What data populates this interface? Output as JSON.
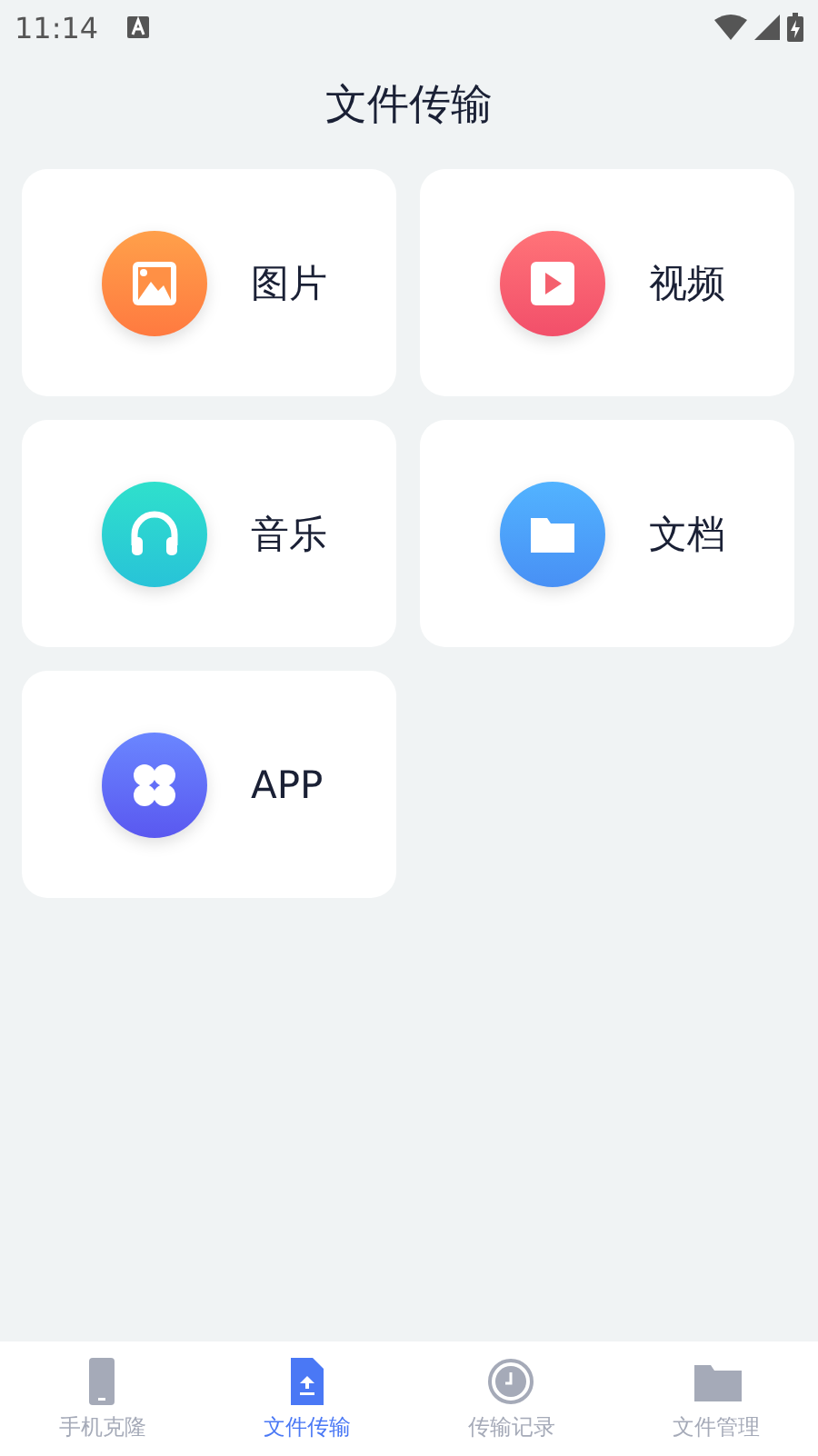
{
  "status_bar": {
    "time": "11:14"
  },
  "title": "文件传输",
  "categories": [
    {
      "kind": "image",
      "label": "图片"
    },
    {
      "kind": "video",
      "label": "视频"
    },
    {
      "kind": "music",
      "label": "音乐"
    },
    {
      "kind": "document",
      "label": "文档"
    },
    {
      "kind": "app",
      "label": "APP"
    }
  ],
  "nav": [
    {
      "kind": "phone",
      "label": "手机克隆",
      "selected": false
    },
    {
      "kind": "upload",
      "label": "文件传输",
      "selected": true
    },
    {
      "kind": "clock",
      "label": "传输记录",
      "selected": false
    },
    {
      "kind": "folder",
      "label": "文件管理",
      "selected": false
    }
  ]
}
